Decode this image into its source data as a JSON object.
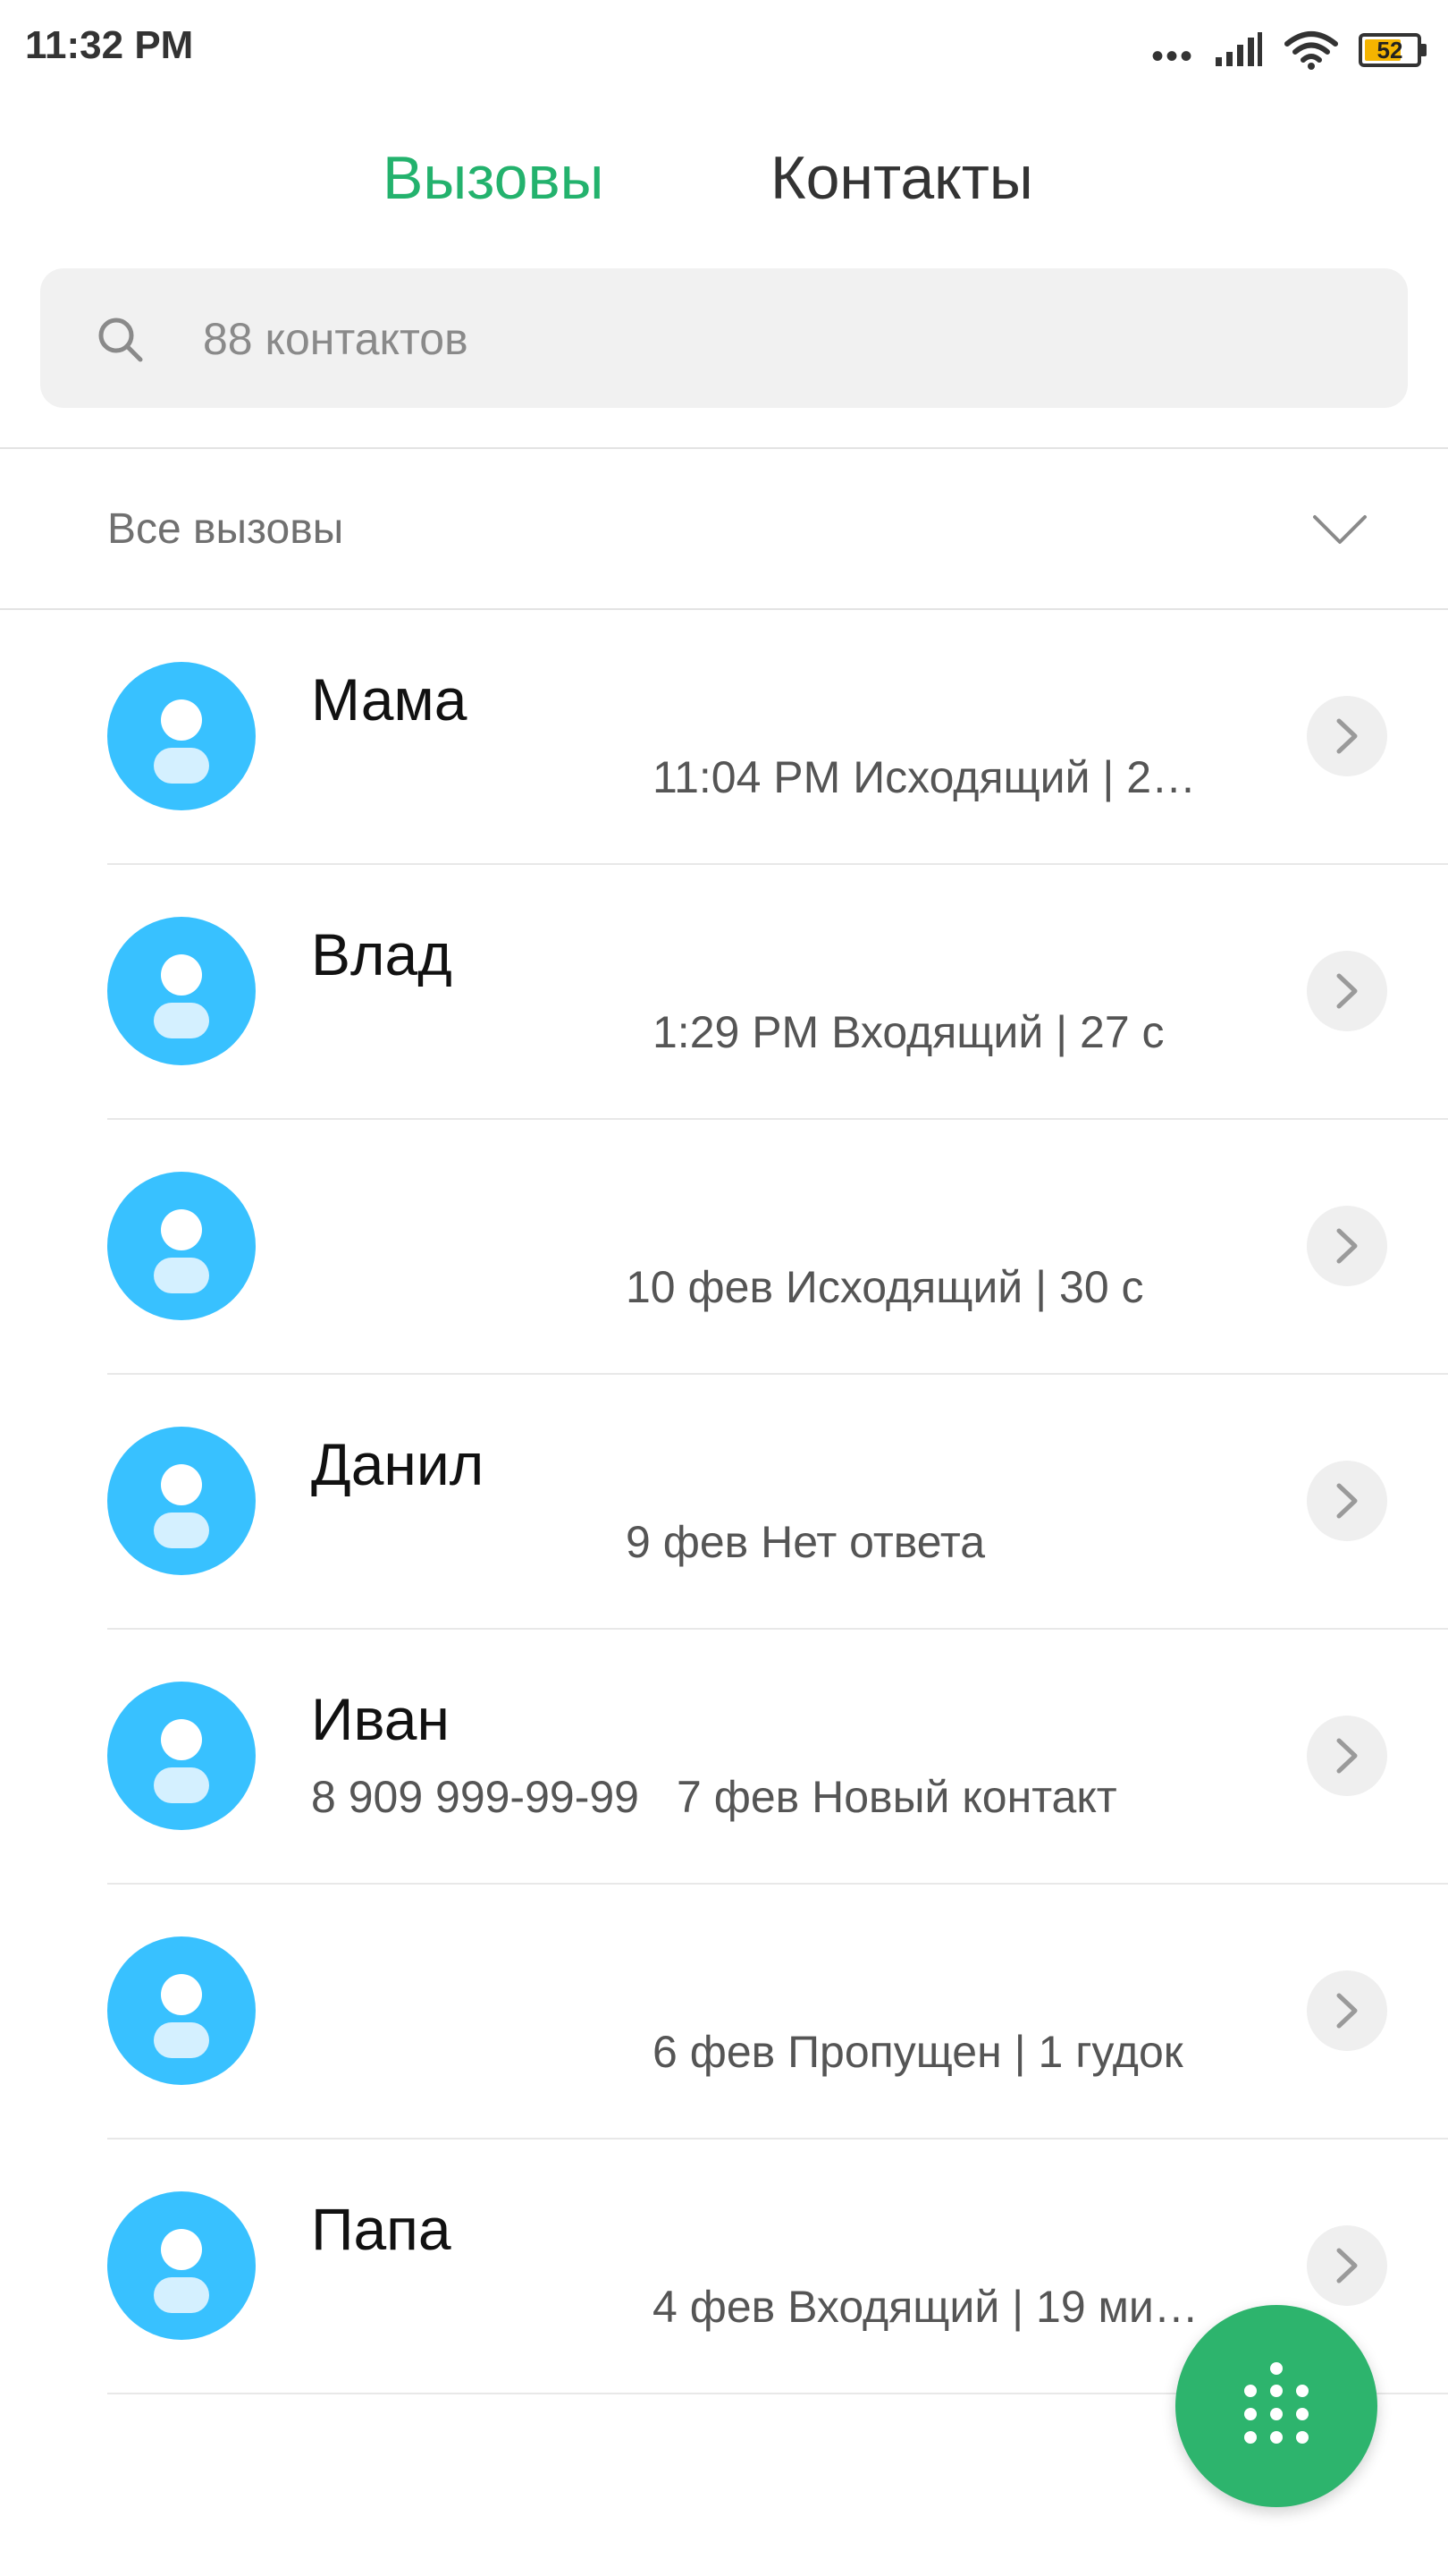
{
  "status_bar": {
    "time": "11:32 PM",
    "battery": "52"
  },
  "tabs": [
    {
      "label": "Вызовы",
      "active": true
    },
    {
      "label": "Контакты",
      "active": false
    }
  ],
  "search": {
    "placeholder": "88 контактов",
    "value": ""
  },
  "filter": {
    "label": "Все вызовы"
  },
  "calls": [
    {
      "name": "Мама",
      "number": "",
      "meta": "11:04 PM Исходящий | 2…"
    },
    {
      "name": "Влад",
      "number": "",
      "meta": "1:29 PM Входящий | 27 с"
    },
    {
      "name": "",
      "number": "",
      "meta": "10 фев Исходящий | 30 с"
    },
    {
      "name": "Данил",
      "number": "",
      "meta": "9 фев Нет ответа"
    },
    {
      "name": "Иван",
      "number": "8 909 999-99-99",
      "meta": "7 фев Новый контакт"
    },
    {
      "name": "",
      "number": "",
      "meta": "6 фев Пропущен | 1 гудок"
    },
    {
      "name": "Папа",
      "number": "",
      "meta": "4 фев Входящий | 19 ми…"
    }
  ],
  "colors": {
    "accent": "#23b26d",
    "avatar": "#38c1ff",
    "fab": "#2db46d"
  },
  "icons": [
    "search-icon",
    "chevron-down-icon",
    "person-icon",
    "chevron-right-icon",
    "dialpad-icon",
    "wifi-icon",
    "signal-icon",
    "battery-icon"
  ]
}
